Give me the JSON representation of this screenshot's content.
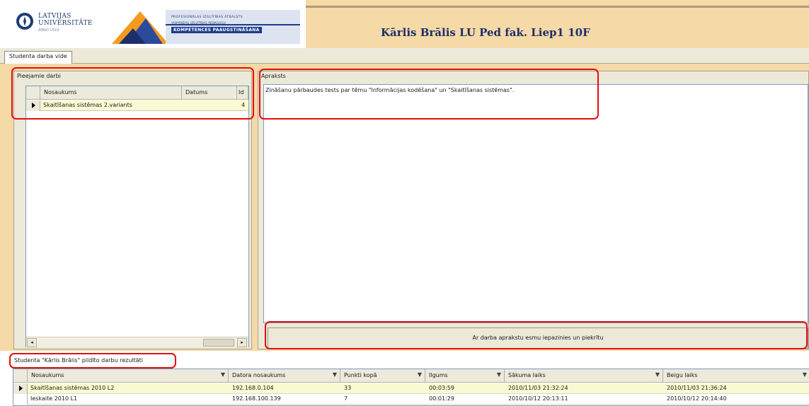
{
  "header": {
    "logo": {
      "line1": "LATVIJAS",
      "line2": "UNIVERSITĀTE",
      "line3": "ANNO 1919"
    },
    "banner": {
      "line1": "PROFESIONĀLAS IZGLĪTĪBAS ATBALSTS",
      "line2": "VISPĀRĒJĀS IZGLĪTĪBAS PEDAGOGU",
      "line3": "KOMPETENCES PAAUGSTINĀŠANA"
    },
    "title": "Kārlis Brālis LU Ped fak. Liep1 10F"
  },
  "tabs": [
    {
      "label": "Studenta darba vide"
    }
  ],
  "left_panel": {
    "title": "Pieejamie darbi",
    "columns": [
      "Nosaukums",
      "Datums",
      "Id"
    ],
    "rows": [
      {
        "name": "Skaitīšanas sistēmas 2.variants",
        "date": "",
        "id": "4"
      }
    ]
  },
  "right_panel": {
    "title": "Apraksts",
    "description": "Zināšanu pārbaudes tests par tēmu \"Informācijas kodēšana\" un \"Skaitīšanas sistēmas\".",
    "confirm_button": "Ar darba aprakstu esmu iepazinies un piekrītu"
  },
  "results": {
    "title": "Studenta \"Kārlis Brālis\" pildīto darbu rezultāti",
    "columns": [
      "Nosaukums",
      "Datora nosaukums",
      "Punkti kopā",
      "Ilgums",
      "Sākuma laiks",
      "Beigu laiks"
    ],
    "rows": [
      {
        "name": "Skaitīšanas sistēmas 2010 L2",
        "computer": "192.168.0.104",
        "points": "33",
        "duration": "00:03:59",
        "start": "2010/11/03 21:32:24",
        "end": "2010/11/03 21:36:24"
      },
      {
        "name": "Ieskaite 2010 L1",
        "computer": "192.168.100.139",
        "points": "7",
        "duration": "00:01:29",
        "start": "2010/10/12 20:13:11",
        "end": "2010/10/12 20:14:40"
      }
    ]
  },
  "colors": {
    "header_background": "#f5d9a6",
    "title_color": "#1c2f6a",
    "annotation_red": "#e01010",
    "selected_row": "#fafad2"
  }
}
